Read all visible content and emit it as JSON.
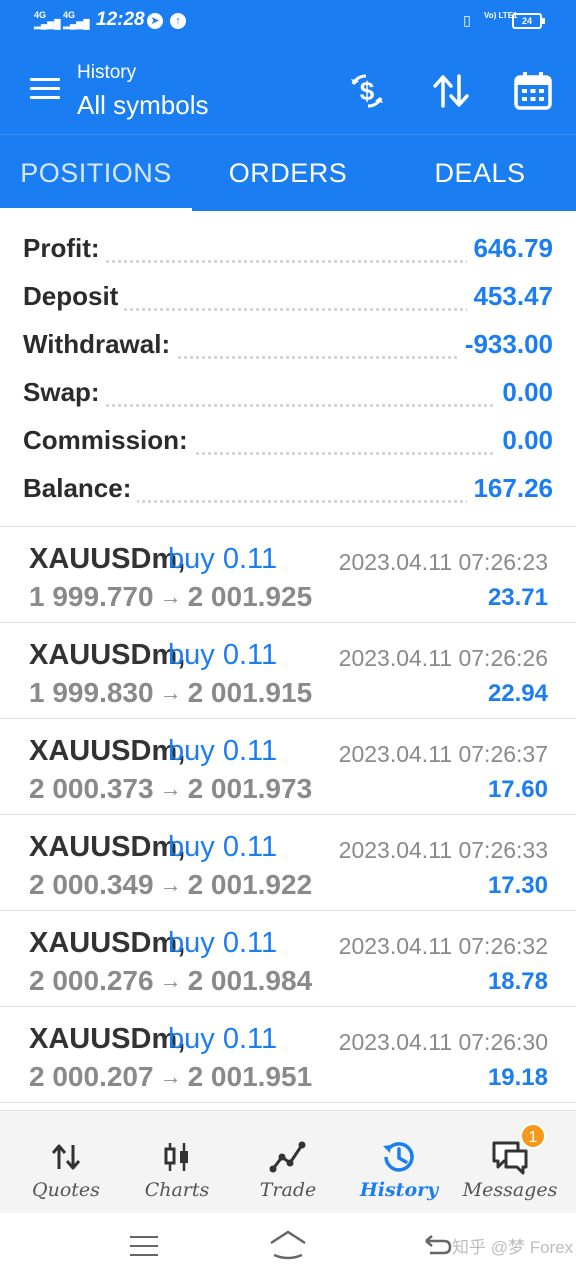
{
  "status_bar": {
    "net1": "4G",
    "net2": "4G",
    "time": "12:28",
    "volte": "Vo) LTE1",
    "battery": "24"
  },
  "header": {
    "subtitle": "History",
    "title": "All symbols",
    "actions": [
      "dollar-refresh-icon",
      "sort-icon",
      "calendar-icon"
    ]
  },
  "tabs": [
    {
      "label": "POSITIONS",
      "active": true
    },
    {
      "label": "ORDERS",
      "active": false
    },
    {
      "label": "DEALS",
      "active": false
    }
  ],
  "summary": [
    {
      "label": "Profit:",
      "value": "646.79"
    },
    {
      "label": "Deposit",
      "value": "453.47"
    },
    {
      "label": "Withdrawal:",
      "value": "-933.00"
    },
    {
      "label": "Swap:",
      "value": "0.00"
    },
    {
      "label": "Commission:",
      "value": "0.00"
    },
    {
      "label": "Balance:",
      "value": "167.26"
    }
  ],
  "deals": [
    {
      "symbol": "XAUUSDm,",
      "side": "buy 0.11",
      "open": "1 999.770",
      "close": "2 001.925",
      "time": "2023.04.11 07:26:23",
      "profit": "23.71"
    },
    {
      "symbol": "XAUUSDm,",
      "side": "buy 0.11",
      "open": "1 999.830",
      "close": "2 001.915",
      "time": "2023.04.11 07:26:26",
      "profit": "22.94"
    },
    {
      "symbol": "XAUUSDm,",
      "side": "buy 0.11",
      "open": "2 000.373",
      "close": "2 001.973",
      "time": "2023.04.11 07:26:37",
      "profit": "17.60"
    },
    {
      "symbol": "XAUUSDm,",
      "side": "buy 0.11",
      "open": "2 000.349",
      "close": "2 001.922",
      "time": "2023.04.11 07:26:33",
      "profit": "17.30"
    },
    {
      "symbol": "XAUUSDm,",
      "side": "buy 0.11",
      "open": "2 000.276",
      "close": "2 001.984",
      "time": "2023.04.11 07:26:32",
      "profit": "18.78"
    },
    {
      "symbol": "XAUUSDm,",
      "side": "buy 0.11",
      "open": "2 000.207",
      "close": "2 001.951",
      "time": "2023.04.11 07:26:30",
      "profit": "19.18"
    }
  ],
  "bottom_nav": [
    {
      "label": "Quotes",
      "icon": "quotes-icon",
      "active": false
    },
    {
      "label": "Charts",
      "icon": "charts-icon",
      "active": false
    },
    {
      "label": "Trade",
      "icon": "trade-icon",
      "active": false
    },
    {
      "label": "History",
      "icon": "history-icon",
      "active": true
    },
    {
      "label": "Messages",
      "icon": "messages-icon",
      "active": false
    }
  ],
  "messages_badge": "1",
  "watermark": "知乎 @梦 Forex",
  "colors": {
    "accent": "#1a7ef2",
    "badge": "#f39a1c"
  }
}
